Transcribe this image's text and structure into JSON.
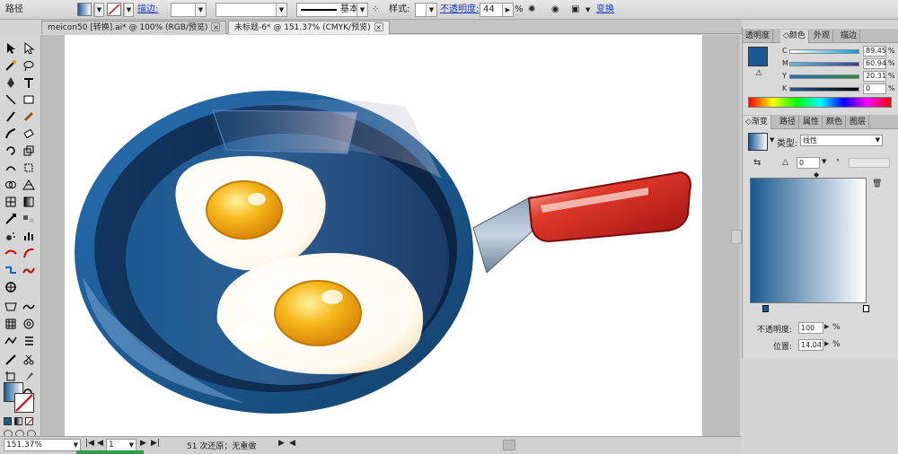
{
  "control_bar": {
    "mode_label": "路径",
    "stroke_label": "描边:",
    "stroke_profile": "基本",
    "style_label": "样式:",
    "opacity_label": "不透明度:",
    "opacity_value": "44",
    "opacity_unit": "%",
    "transform_label": "变换"
  },
  "tabs": [
    {
      "label": "meicon50 [转换].ai* @ 100% (RGB/预览)"
    },
    {
      "label": "未标题-6* @ 151.37% (CMYK/预览)"
    }
  ],
  "color_panel": {
    "tabs": [
      "透明度",
      "颜色",
      "外观",
      "描边"
    ],
    "active_tab": "颜色",
    "channels": [
      {
        "name": "C",
        "value": "89.45",
        "unit": "%"
      },
      {
        "name": "M",
        "value": "60.94",
        "unit": "%"
      },
      {
        "name": "Y",
        "value": "20.31",
        "unit": "%"
      },
      {
        "name": "K",
        "value": "0",
        "unit": "%"
      }
    ],
    "fill_color": "#1b5a92"
  },
  "gradient_panel": {
    "tabs": [
      "渐变",
      "路径",
      "属性",
      "颜色",
      "图层"
    ],
    "active_tab": "渐变",
    "type_label": "类型:",
    "type_value": "线性",
    "angle_value": "0",
    "opacity_label": "不透明度:",
    "opacity_value": "100",
    "location_label": "位置:",
    "location_value": "14.04",
    "unit": "%",
    "start_color": "#1b5a92",
    "end_color": "#ffffff"
  },
  "status_bar": {
    "zoom": "151.37%",
    "page": "1",
    "message": "51 次还原；无重做"
  },
  "colors": {
    "pan_outer": "#1b5a92",
    "pan_inner": "#0f2c4f",
    "handle_red": "#c01a1a",
    "yolk": "#f3a90f",
    "egg_white": "#fffaf0"
  }
}
